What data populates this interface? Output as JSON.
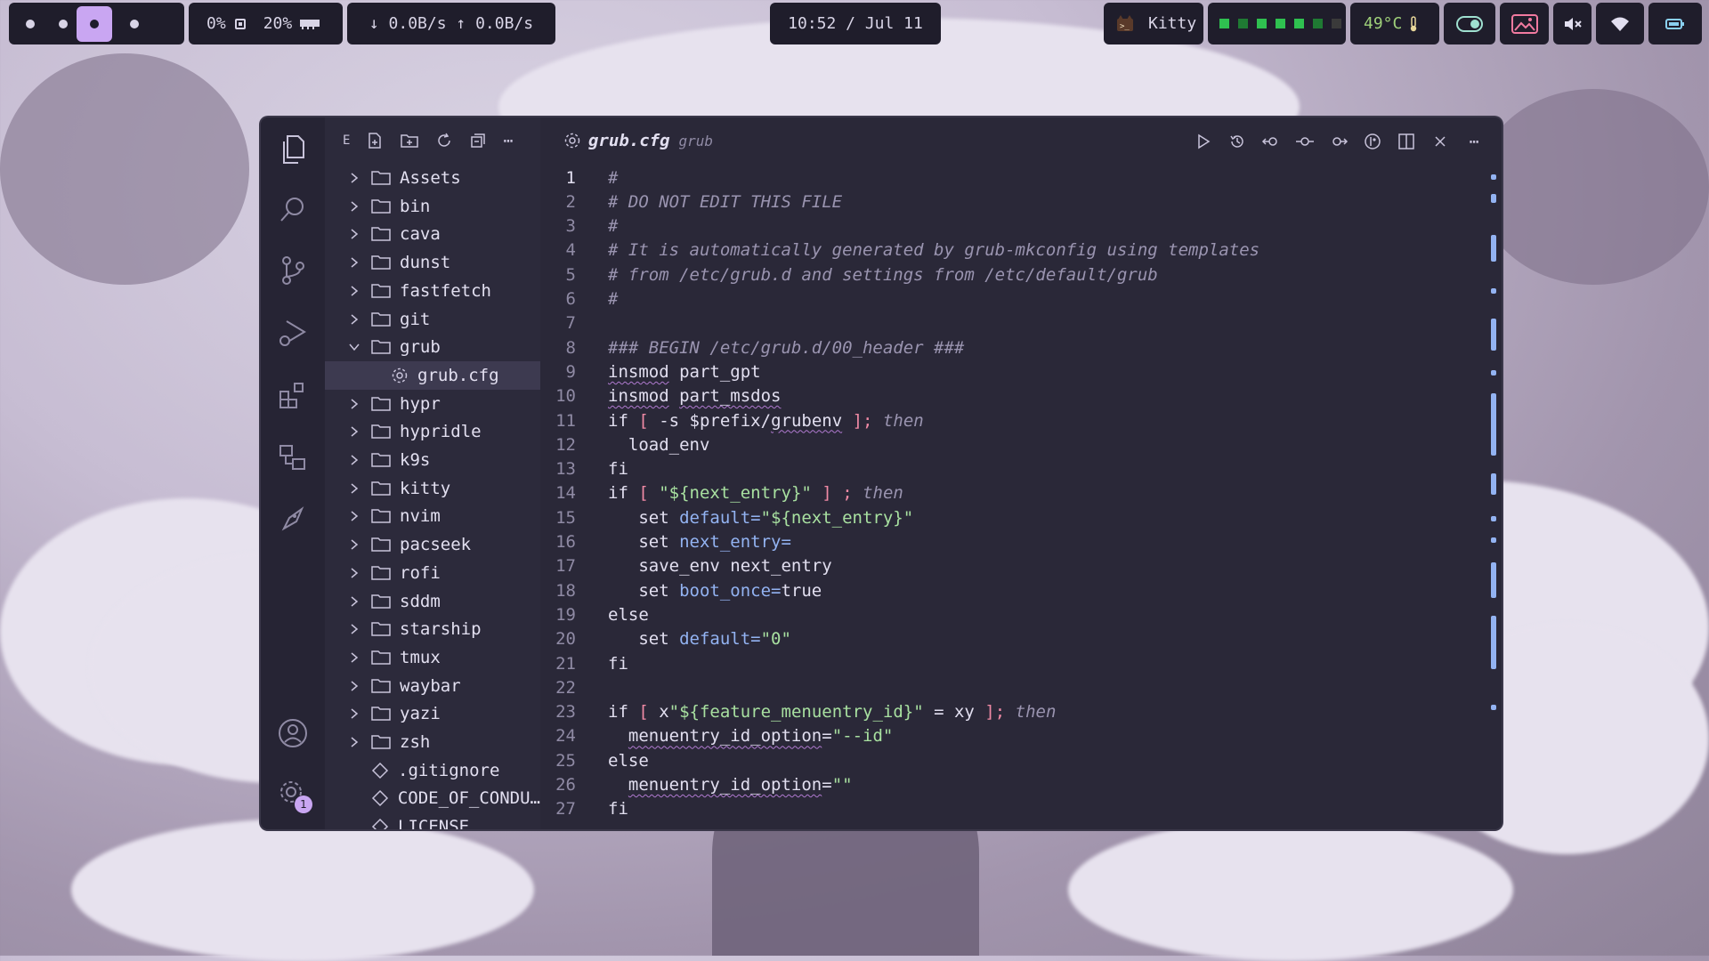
{
  "topbar": {
    "workspaces": [
      "1",
      "2",
      "3",
      "4"
    ],
    "active_workspace": 3,
    "cpu": "0%",
    "mem": "20%",
    "net": "↓ 0.0B/s ↑ 0.0B/s",
    "clock": "10:52 / Jul 11",
    "window_title": "Kitty",
    "temp": "49°C"
  },
  "editor": {
    "explorer_label": "E",
    "tab": {
      "title": "grub.cfg",
      "subtitle": "grub"
    },
    "tree": [
      {
        "label": "Assets",
        "type": "folder"
      },
      {
        "label": "bin",
        "type": "folder"
      },
      {
        "label": "cava",
        "type": "folder"
      },
      {
        "label": "dunst",
        "type": "folder"
      },
      {
        "label": "fastfetch",
        "type": "folder"
      },
      {
        "label": "git",
        "type": "folder"
      },
      {
        "label": "grub",
        "type": "folder-open"
      },
      {
        "label": "grub.cfg",
        "type": "file-selected"
      },
      {
        "label": "hypr",
        "type": "folder"
      },
      {
        "label": "hypridle",
        "type": "folder"
      },
      {
        "label": "k9s",
        "type": "folder"
      },
      {
        "label": "kitty",
        "type": "folder"
      },
      {
        "label": "nvim",
        "type": "folder"
      },
      {
        "label": "pacseek",
        "type": "folder"
      },
      {
        "label": "rofi",
        "type": "folder"
      },
      {
        "label": "sddm",
        "type": "folder"
      },
      {
        "label": "starship",
        "type": "folder"
      },
      {
        "label": "tmux",
        "type": "folder"
      },
      {
        "label": "waybar",
        "type": "folder"
      },
      {
        "label": "yazi",
        "type": "folder"
      },
      {
        "label": "zsh",
        "type": "folder"
      },
      {
        "label": ".gitignore",
        "type": "file"
      },
      {
        "label": "CODE_OF_CONDU…",
        "type": "file"
      },
      {
        "label": "LICENSE",
        "type": "file"
      }
    ],
    "lines": [
      "1",
      "2",
      "3",
      "4",
      "5",
      "6",
      "7",
      "8",
      "9",
      "10",
      "11",
      "12",
      "13",
      "14",
      "15",
      "16",
      "17",
      "18",
      "19",
      "20",
      "21",
      "22",
      "23",
      "24",
      "25",
      "26",
      "27"
    ],
    "code": [
      "#",
      "# DO NOT EDIT THIS FILE",
      "#",
      "# It is automatically generated by grub-mkconfig using templates",
      "# from /etc/grub.d and settings from /etc/default/grub",
      "#",
      "",
      "### BEGIN /etc/grub.d/00_header ###",
      "insmod part_gpt",
      "insmod part_msdos",
      "if [ -s $prefix/grubenv ]; then",
      "  load_env",
      "fi",
      "if [ \"${next_entry}\" ] ; then",
      "   set default=\"${next_entry}\"",
      "   set next_entry=",
      "   save_env next_entry",
      "   set boot_once=true",
      "else",
      "   set default=\"0\"",
      "fi",
      "",
      "if [ x\"${feature_menuentry_id}\" = xy ]; then",
      "  menuentry_id_option=\"--id\"",
      "else",
      "  menuentry_id_option=\"\"",
      "fi"
    ],
    "settings_badge": "1"
  },
  "colors": {
    "accent": "#c9a6f2",
    "bar_bg": "#1f1d2b",
    "editor_bg": "#2a2838",
    "string": "#a8e0a0",
    "variable": "#93b3f2",
    "bracket": "#f08aa5"
  }
}
